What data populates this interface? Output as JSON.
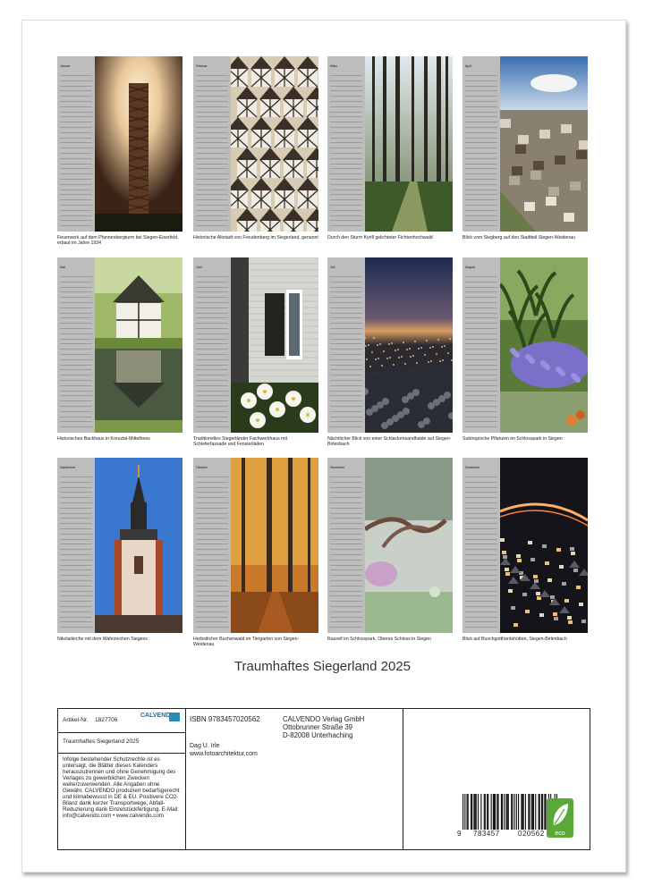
{
  "months": [
    {
      "name": "Januar",
      "caption": "Feuerwerk auf dem Pfannenbergturm bei Siegen-Eiserfeld, erbaut im Jahre 1934"
    },
    {
      "name": "Februar",
      "caption": "Historische Altstadt von Freudenberg im Siegerland, genannt"
    },
    {
      "name": "März",
      "caption": "Durch den Sturm Kyrill gelichteter Fichtenhochwald"
    },
    {
      "name": "April",
      "caption": "Blick vom Siegberg auf den Stadtteil Siegen-Weidenau"
    },
    {
      "name": "Mai",
      "caption": "Historisches Backhaus in Kreuztal-Mittelhees"
    },
    {
      "name": "Juni",
      "caption": "Traditionelles Siegerländer Fachwerkhaus mit Schieferfassade und Fensterläden"
    },
    {
      "name": "Juli",
      "caption": "Nächtlicher Blick von einer Schlackensandhalde auf Siegen-Birlenbach"
    },
    {
      "name": "August",
      "caption": "Subtropische Pflanzen im Schlosspark in Siegen"
    },
    {
      "name": "September",
      "caption": "Nikolaikirche mit dem Wahrzeichen Siegens"
    },
    {
      "name": "Oktober",
      "caption": "Herbstlicher Buchenwald im Tiergarten von Siegen-Weidenau"
    },
    {
      "name": "November",
      "caption": "Raureif im Schlosspark, Oberes Schloss in Siegen"
    },
    {
      "name": "Dezember",
      "caption": "Blick auf Buschgotthardshütten, Siegen-Birlenbach"
    }
  ],
  "calendar_title": "Traumhaftes Siegerland 2025",
  "info": {
    "artikel_label": "Artikel-Nr.",
    "artikel_nr": "1827706",
    "brand": "CALVENDO",
    "product_title": "Traumhaftes Siegerland 2025",
    "legal_text": "Infolge bestehender Schutzrechte ist es untersagt, die Blätter dieses Kalenders herauszutrennen und ohne Genehmigung des Verlages zu gewerblichen Zwecken weiterzuverwenden. Alle Angaben ohne Gewähr. CALVENDO produziert bedarfsgerecht und klimabewusst in DE & EU. Positivere CO2-Bilanz dank kurzer Transportwege, Abfall-Reduzierung dank Einzelstückfertigung. E-Mail: info@calvendo.com • www.calvendo.com",
    "isbn": "ISBN 9783457020562",
    "publisher_name": "CALVENDO Verlag GmbH",
    "publisher_street": "Ottobrunner Straße 39",
    "publisher_city": "D-82008 Unterhaching",
    "author": "Dag U. Irle",
    "website": "www.fotoarchitektur.com",
    "barcode_left": "9",
    "barcode_mid1": "783457",
    "barcode_mid2": "020562",
    "eco_label": "eco"
  }
}
